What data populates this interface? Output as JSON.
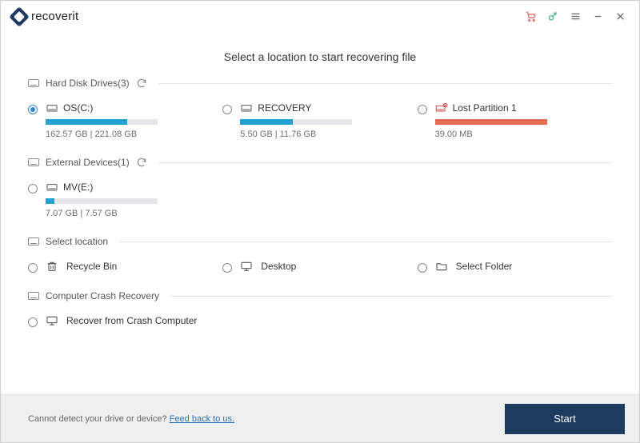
{
  "brand": "recoverit",
  "heading": "Select a location to start recovering file",
  "sections": {
    "hdd_label": "Hard Disk Drives(3)",
    "ext_label": "External Devices(1)",
    "loc_label": "Select location",
    "crash_label": "Computer Crash Recovery"
  },
  "drives": {
    "hdd": [
      {
        "name": "OS(C:)",
        "size": "162.57  GB | 221.08  GB",
        "fill_pct": 73,
        "color": "blue",
        "lost": false
      },
      {
        "name": "RECOVERY",
        "size": "5.50  GB | 11.76  GB",
        "fill_pct": 47,
        "color": "blue",
        "lost": false
      },
      {
        "name": "Lost Partition 1",
        "size": "39.00  MB",
        "fill_pct": 100,
        "color": "red",
        "lost": true
      }
    ],
    "ext": [
      {
        "name": "MV(E:)",
        "size": "7.07  GB | 7.57  GB",
        "fill_pct": 8,
        "color": "blue",
        "lost": false
      }
    ]
  },
  "locations": {
    "recycle": "Recycle Bin",
    "desktop": "Desktop",
    "folder": "Select Folder"
  },
  "crash_option": "Recover from Crash Computer",
  "footer": {
    "msg": "Cannot detect your drive or device?",
    "link": "Feed back to us.",
    "start": "Start"
  }
}
